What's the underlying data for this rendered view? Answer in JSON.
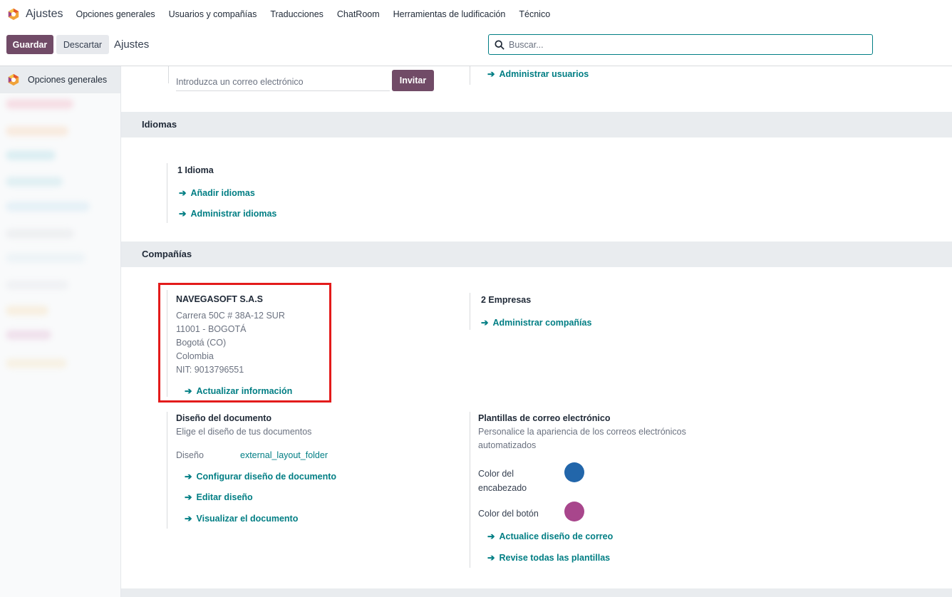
{
  "navbar": {
    "app_name": "Ajustes",
    "menu": [
      "Opciones generales",
      "Usuarios y compañías",
      "Traducciones",
      "ChatRoom",
      "Herramientas de ludificación",
      "Técnico"
    ]
  },
  "control": {
    "save_label": "Guardar",
    "discard_label": "Descartar",
    "breadcrumb": "Ajustes",
    "search_placeholder": "Buscar..."
  },
  "sidebar": {
    "active_label": "Opciones generales"
  },
  "users": {
    "email_placeholder": "Introduzca un correo electrónico",
    "invite_label": "Invitar",
    "manage_users": "Administrar usuarios"
  },
  "languages": {
    "title": "Idiomas",
    "count": "1 Idioma",
    "add": "Añadir idiomas",
    "manage": "Administrar idiomas"
  },
  "companies": {
    "title": "Compañías",
    "company_name": "NAVEGASOFT S.A.S",
    "address_lines": [
      "Carrera 50C # 38A-12 SUR",
      "11001 - BOGOTÁ",
      "Bogotá (CO)",
      "Colombia",
      "NIT:  9013796551"
    ],
    "update_info": "Actualizar información",
    "count": "2 Empresas",
    "manage": "Administrar compañías"
  },
  "document_layout": {
    "title": "Diseño del documento",
    "description": "Elige el diseño de tus documentos",
    "layout_label": "Diseño",
    "layout_value": "external_layout_folder",
    "configure": "Configurar diseño de documento",
    "edit": "Editar diseño",
    "preview": "Visualizar el documento"
  },
  "email_templates": {
    "title": "Plantillas de correo electrónico",
    "description_1": "Personalice la apariencia de los correos electrónicos",
    "description_2": "automatizados",
    "header_color_label_1": "Color del",
    "header_color_label_2": "encabezado",
    "header_color": "#2266aa",
    "button_color_label": "Color del botón",
    "button_color": "#a8468c",
    "update_layout": "Actualice diseño de correo",
    "review_templates": "Revise todas las plantillas"
  },
  "colors": {
    "brand": "#714b67",
    "link": "#017e84",
    "highlight": "#e31b1b"
  }
}
